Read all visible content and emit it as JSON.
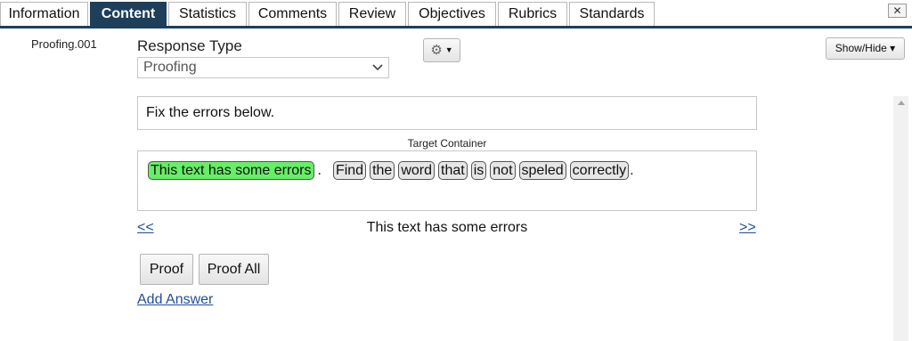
{
  "tabs": [
    {
      "label": "Information",
      "active": false
    },
    {
      "label": "Content",
      "active": true
    },
    {
      "label": "Statistics",
      "active": false
    },
    {
      "label": "Comments",
      "active": false
    },
    {
      "label": "Review",
      "active": false
    },
    {
      "label": "Objectives",
      "active": false
    },
    {
      "label": "Rubrics",
      "active": false
    },
    {
      "label": "Standards",
      "active": false
    }
  ],
  "close_label": "✕",
  "item_id": "Proofing.001",
  "response_type": {
    "label": "Response Type",
    "selected": "Proofing"
  },
  "show_hide_label": "Show/Hide ▾",
  "prompt": "Fix the errors below.",
  "target": {
    "label": "Target Container",
    "tokens": [
      {
        "text": "This text has some errors",
        "selected": true
      },
      {
        "punct": "."
      },
      {
        "text": "Find"
      },
      {
        "text": "the"
      },
      {
        "text": "word"
      },
      {
        "text": "that"
      },
      {
        "text": "is"
      },
      {
        "text": "not"
      },
      {
        "text": "speled"
      },
      {
        "text": "correctly"
      },
      {
        "punct": "."
      }
    ]
  },
  "navigator": {
    "prev": "<<",
    "current": "This text has some errors",
    "next": ">>"
  },
  "buttons": {
    "proof": "Proof",
    "proof_all": "Proof All"
  },
  "add_answer": "Add Answer",
  "colors": {
    "active_tab": "#1e3f5a",
    "selected_word": "#66ee66",
    "link": "#1f4e9c"
  },
  "icons": {
    "settings": "gear-icon",
    "settings_caret": "caret-down-icon",
    "select_caret": "chevron-down-icon",
    "close": "close-icon"
  }
}
